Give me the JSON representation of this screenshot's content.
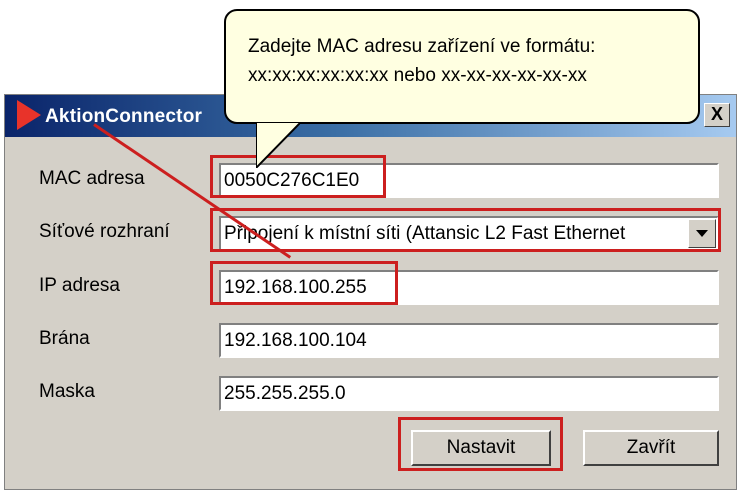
{
  "window": {
    "title": "AktionConnector",
    "close_label": "X"
  },
  "tooltip": {
    "line1": "Zadejte MAC adresu zařízení ve formátu:",
    "line2": "xx:xx:xx:xx:xx:xx nebo xx-xx-xx-xx-xx-xx"
  },
  "form": {
    "mac": {
      "label": "MAC adresa",
      "value": "0050C276C1E0"
    },
    "interface": {
      "label": "Síťové rozhraní",
      "value": "Připojení k místní síti (Attansic L2 Fast Ethernet"
    },
    "ip": {
      "label": "IP adresa",
      "value": "192.168.100.255"
    },
    "gateway": {
      "label": "Brána",
      "value": "192.168.100.104"
    },
    "mask": {
      "label": "Maska",
      "value": "255.255.255.0"
    }
  },
  "buttons": {
    "set": "Nastavit",
    "close": "Zavřít"
  },
  "colors": {
    "highlight": "#cc1f1f",
    "tooltip_bg": "#ffffe1",
    "dialog_bg": "#d4d0c8"
  }
}
